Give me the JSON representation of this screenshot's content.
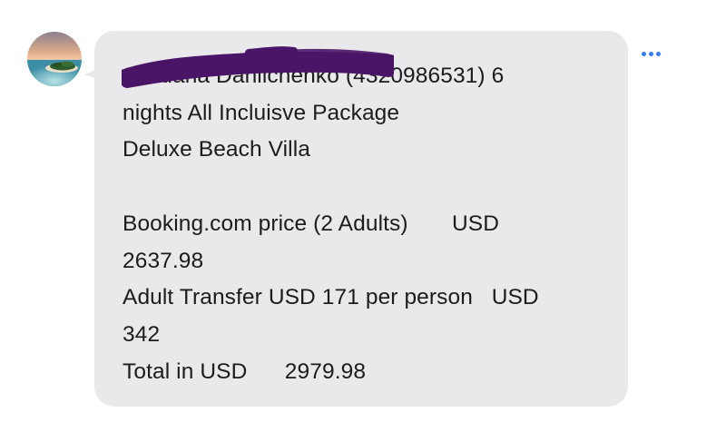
{
  "message": {
    "text": "Svetlana Danilchenko (4320986531) 6\nnights All Incluisve Package\nDeluxe Beach Villa\n\nBooking.com price (2 Adults)       USD\n2637.98\nAdult Transfer USD 171 per person   USD\n342\nTotal in USD      2979.98",
    "bubble_color": "#e9e9eb",
    "text_color": "#1c1c1e"
  },
  "sender": {
    "avatar_icon": "tropical-island-avatar"
  },
  "actions": {
    "more_icon": "ellipsis-icon",
    "accent_color": "#2f7cf6"
  },
  "redaction": {
    "color": "#4a1566"
  }
}
